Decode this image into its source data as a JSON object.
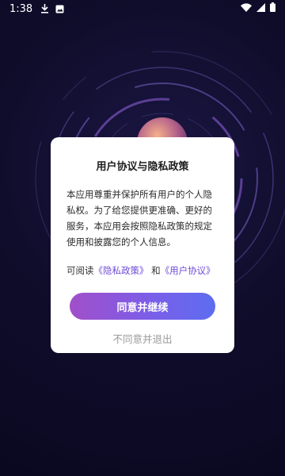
{
  "status_bar": {
    "time": "1:38",
    "left_icons": [
      "download-icon",
      "image-icon"
    ],
    "right_icons": [
      "wifi-icon",
      "signal-icon",
      "battery-icon"
    ]
  },
  "dialog": {
    "title": "用户协议与隐私政策",
    "body_lines": [
      "本应用尊重并保护所有用户的个人隐",
      "私权。为了给您提供更准确、更好的",
      "服务，本应用会按照隐私政策的规定",
      "使用和披露您的个人信息。"
    ],
    "links_prefix": "可阅读",
    "privacy_link": "《隐私政策》",
    "links_joiner": "和",
    "agreement_link": "《用户协议》",
    "agree_label": "同意并继续",
    "disagree_label": "不同意并退出"
  },
  "colors": {
    "accent_link": "#6f4bd8",
    "button_start": "#a14fc9",
    "button_end": "#5d6df0",
    "background": "#0c0a24"
  }
}
